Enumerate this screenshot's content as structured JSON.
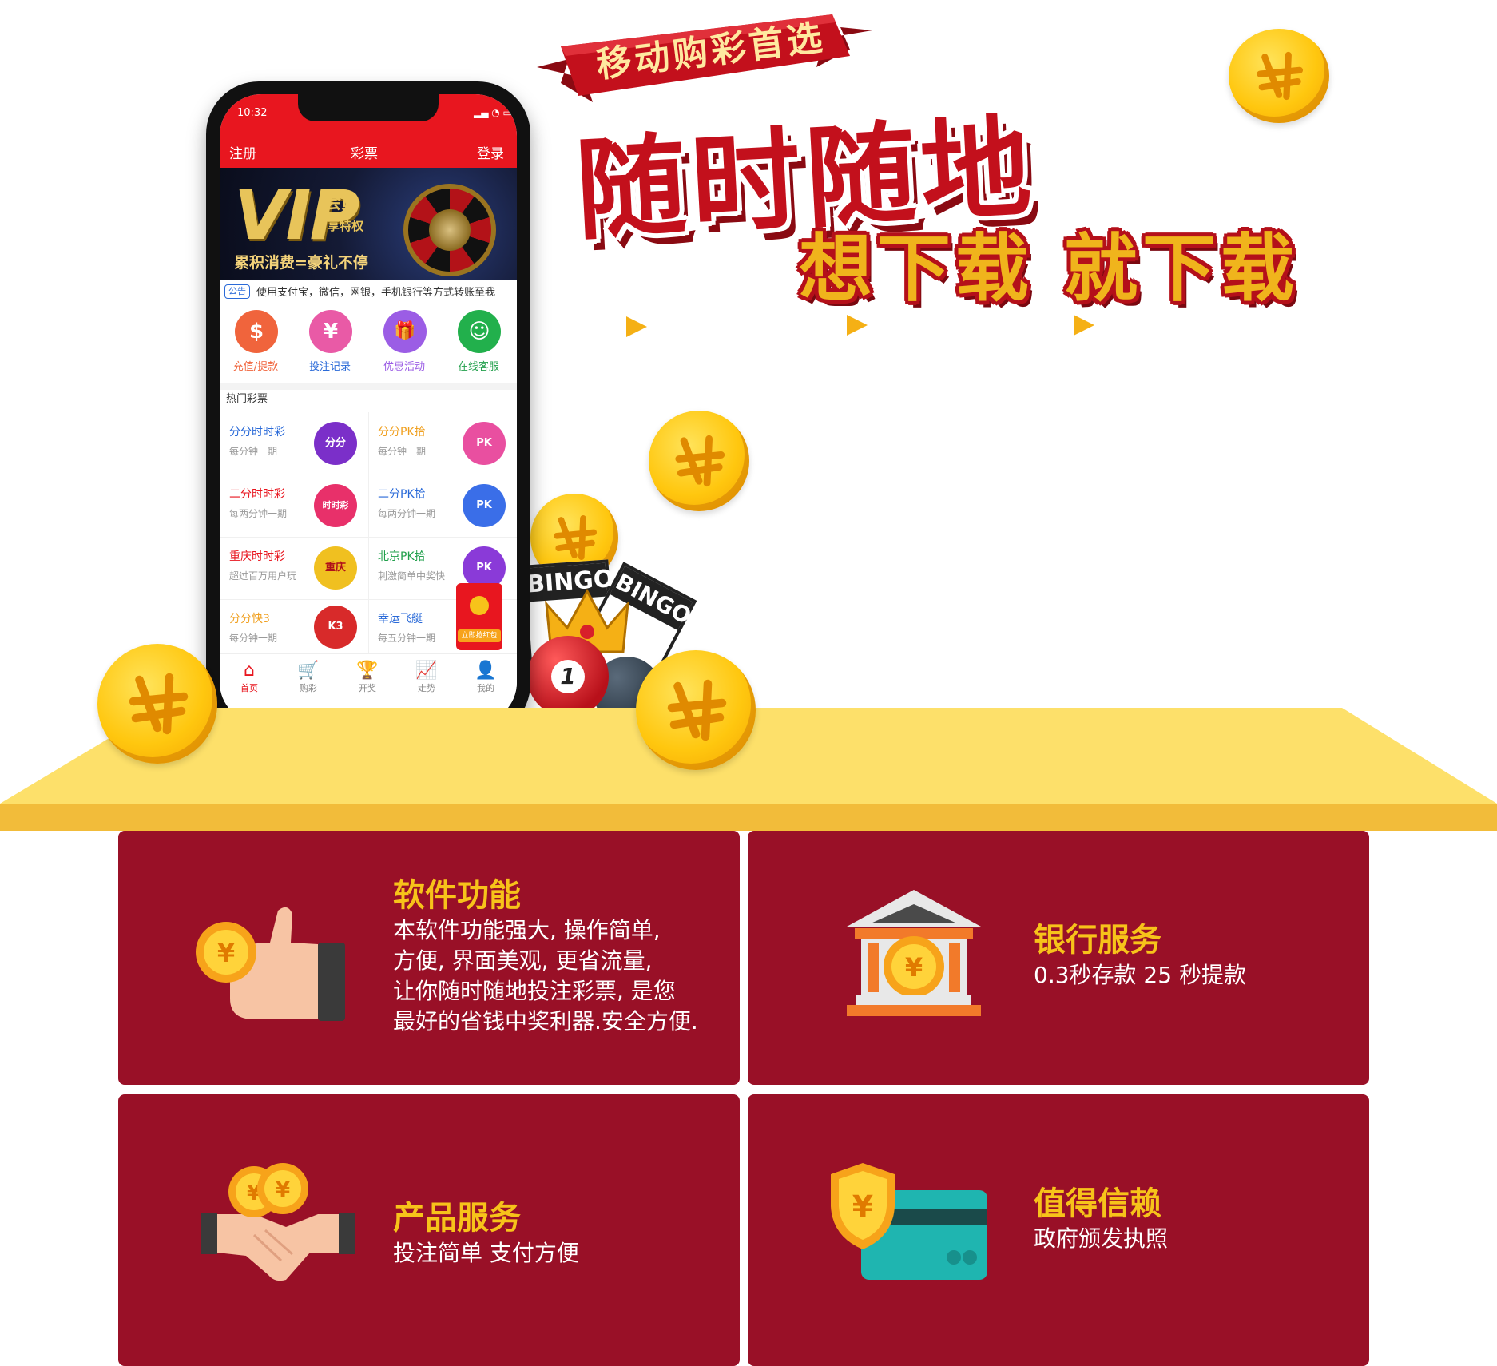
{
  "hero": {
    "ribbon_text": "移动购彩首选",
    "headline": "随时随地",
    "subline": "想下载 就下载"
  },
  "phone": {
    "status_time": "10:32",
    "nav": {
      "left": "注册",
      "title": "彩票",
      "right": "登录"
    },
    "banner": {
      "vip": "VIP",
      "member": "会员",
      "privilege": "专享特权",
      "slogan": "累积消费=豪礼不停"
    },
    "notice": {
      "tag": "公告",
      "text": "使用支付宝，微信，网银，手机银行等方式转账至我"
    },
    "quick_actions": [
      {
        "label": "充值/提款",
        "icon": "money-bag-icon",
        "symbol": "$",
        "color": "#f0643c"
      },
      {
        "label": "投注记录",
        "icon": "record-icon",
        "symbol": "¥",
        "color": "#e95aa6"
      },
      {
        "label": "优惠活动",
        "icon": "gift-icon",
        "symbol": "🎁",
        "color": "#9b5de5"
      },
      {
        "label": "在线客服",
        "icon": "service-icon",
        "symbol": "☺",
        "color": "#22b04c"
      }
    ],
    "hot_title": "热门彩票",
    "lotteries": [
      {
        "name": "分分时时彩",
        "desc": "每分钟一期",
        "badge": "分分",
        "name_color": "#2a6ad8",
        "icon_color": "#7b2fc9"
      },
      {
        "name": "分分PK拾",
        "desc": "每分钟一期",
        "badge": "PK",
        "name_color": "#f0a020",
        "icon_color": "#e94fa0"
      },
      {
        "name": "二分时时彩",
        "desc": "每两分钟一期",
        "badge": "时时彩",
        "name_color": "#e8161f",
        "icon_color": "#e8306a"
      },
      {
        "name": "二分PK拾",
        "desc": "每两分钟一期",
        "badge": "PK",
        "name_color": "#2a6ad8",
        "icon_color": "#3a6ee8"
      },
      {
        "name": "重庆时时彩",
        "desc": "超过百万用户玩",
        "badge": "重庆",
        "name_color": "#e8161f",
        "icon_color": "#f0c020"
      },
      {
        "name": "北京PK拾",
        "desc": "刺激简单中奖快",
        "badge": "PK",
        "name_color": "#22a04c",
        "icon_color": "#8a3ad8"
      },
      {
        "name": "分分快3",
        "desc": "每分钟一期",
        "badge": "K3",
        "name_color": "#f0a020",
        "icon_color": "#d82a2a"
      },
      {
        "name": "幸运飞艇",
        "desc": "每五分钟一期",
        "badge": "",
        "name_color": "#2a6ad8",
        "icon_color": "#e8161f"
      }
    ],
    "red_packet_label": "立即抢红包",
    "tabs": [
      {
        "label": "首页",
        "icon": "home-icon",
        "glyph": "⌂",
        "active": true
      },
      {
        "label": "购彩",
        "icon": "cart-icon",
        "glyph": "🛒",
        "active": false
      },
      {
        "label": "开奖",
        "icon": "trophy-icon",
        "glyph": "🏆",
        "active": false
      },
      {
        "label": "走势",
        "icon": "chart-icon",
        "glyph": "📈",
        "active": false
      },
      {
        "label": "我的",
        "icon": "user-icon",
        "glyph": "👤",
        "active": false
      }
    ]
  },
  "decor": {
    "bingo_1": "BINGO",
    "bingo_2": "BINGO",
    "ball_number": "1"
  },
  "features": [
    {
      "title": "软件功能",
      "lines": [
        "本软件功能强大, 操作简单,",
        "方便, 界面美观, 更省流量,",
        "让你随时随地投注彩票, 是您",
        "最好的省钱中奖利器.安全方便."
      ],
      "icon": "thumbs-up-coin-icon"
    },
    {
      "title": "银行服务",
      "lines": [
        "0.3秒存款 25 秒提款"
      ],
      "icon": "bank-icon"
    },
    {
      "title": "产品服务",
      "lines": [
        "投注简单 支付方便"
      ],
      "icon": "handshake-icon"
    },
    {
      "title": "值得信赖",
      "lines": [
        "政府颁发执照"
      ],
      "icon": "shield-card-icon"
    }
  ],
  "colors": {
    "red": "#e8161f",
    "card": "#991027",
    "gold": "#f7c31a",
    "table": "#fde06a"
  }
}
